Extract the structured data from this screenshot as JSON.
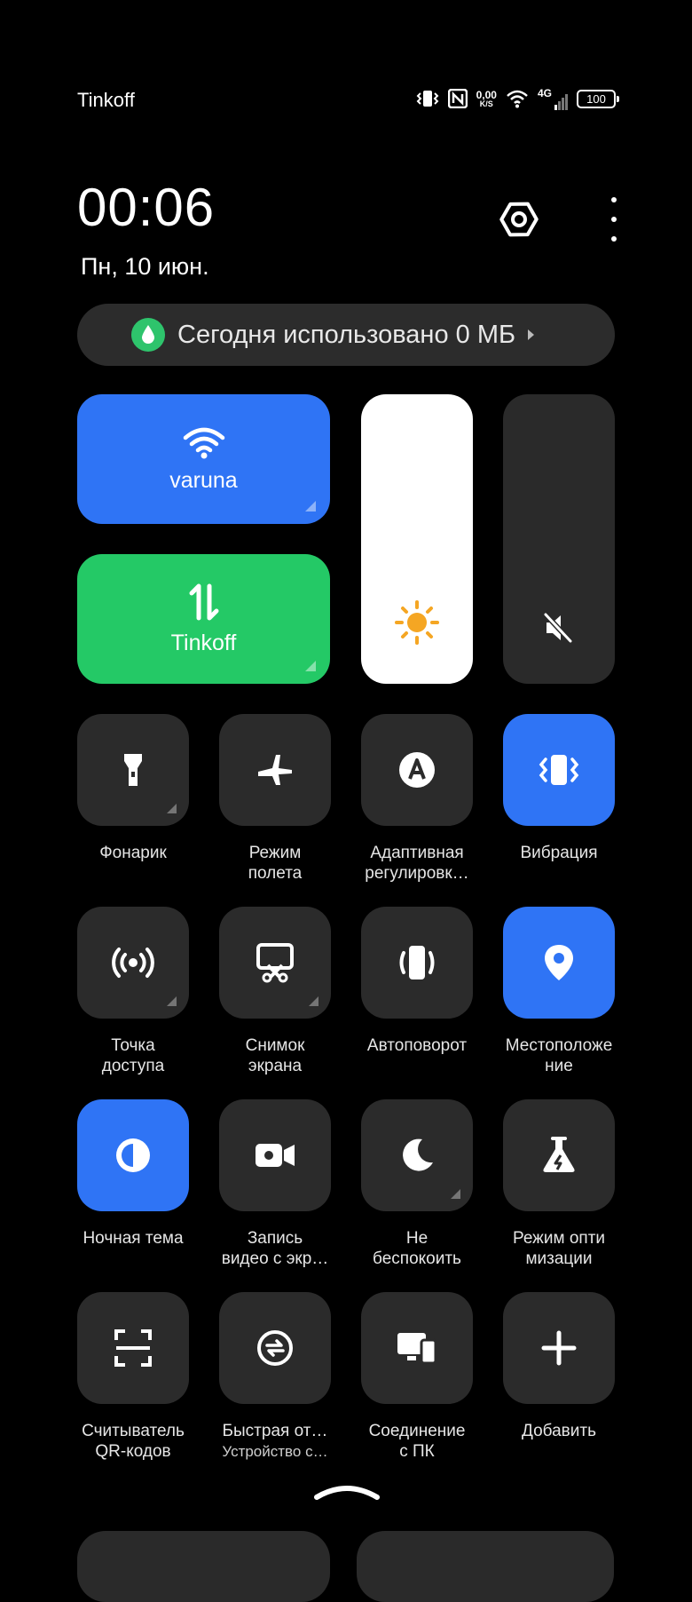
{
  "status_bar": {
    "carrier": "Tinkoff",
    "speed_value": "0,00",
    "speed_unit": "K/S",
    "network_type": "4G",
    "battery": "100",
    "icons": [
      "vibrate-icon",
      "nfc-icon",
      "wifi-icon",
      "cellular-signal-icon",
      "battery-icon"
    ]
  },
  "header": {
    "time": "00:06",
    "date": "Пн, 10 июн."
  },
  "data_usage": {
    "text": "Сегодня использовано 0 МБ"
  },
  "wifi_tile": {
    "label": "varuna",
    "active": true
  },
  "mobile_data_tile": {
    "label": "Tinkoff",
    "active": true
  },
  "sliders": {
    "brightness_level": 1.0,
    "volume_muted": true
  },
  "tiles": [
    {
      "icon": "flashlight-icon",
      "line1": "Фонарик",
      "line2": "",
      "active": false,
      "expandable": true
    },
    {
      "icon": "airplane-icon",
      "line1": "Режим",
      "line2": "полета",
      "active": false,
      "expandable": false
    },
    {
      "icon": "auto-brightness-icon",
      "line1": "Адаптивная",
      "line2": "регулировк…",
      "active": false,
      "expandable": false
    },
    {
      "icon": "vibrate-icon",
      "line1": "Вибрация",
      "line2": "",
      "active": true,
      "expandable": false
    },
    {
      "icon": "hotspot-icon",
      "line1": "Точка",
      "line2": "доступа",
      "active": false,
      "expandable": true
    },
    {
      "icon": "screenshot-icon",
      "line1": "Снимок",
      "line2": "экрана",
      "active": false,
      "expandable": true
    },
    {
      "icon": "auto-rotate-icon",
      "line1": "Автоповорот",
      "line2": "",
      "active": false,
      "expandable": false
    },
    {
      "icon": "location-icon",
      "line1": "Местоположе",
      "line2": "ние",
      "active": true,
      "expandable": false
    },
    {
      "icon": "dark-mode-icon",
      "line1": "Ночная тема",
      "line2": "",
      "active": true,
      "expandable": false
    },
    {
      "icon": "screen-record-icon",
      "line1": "Запись",
      "line2": "видео с экр…",
      "active": false,
      "expandable": false
    },
    {
      "icon": "do-not-disturb-icon",
      "line1": "Не",
      "line2": "беспокоить",
      "active": false,
      "expandable": true
    },
    {
      "icon": "optimization-mode-icon",
      "line1": "Режим опти",
      "line2": "мизации",
      "active": false,
      "expandable": false
    },
    {
      "icon": "qr-scanner-icon",
      "line1": "Считыватель",
      "line2": "QR-кодов",
      "active": false,
      "expandable": false
    },
    {
      "icon": "quick-share-icon",
      "line1": "Быстрая от…",
      "line2": "Устройство с…",
      "active": false,
      "expandable": false,
      "subtitle": true
    },
    {
      "icon": "pc-connect-icon",
      "line1": "Соединение",
      "line2": "с ПК",
      "active": false,
      "expandable": false
    },
    {
      "icon": "add-icon",
      "line1": "Добавить",
      "line2": "",
      "active": false,
      "expandable": false
    }
  ],
  "colors": {
    "background": "#000000",
    "tile": "#2b2b2b",
    "accent_blue": "#2f74f5",
    "accent_green": "#24c966",
    "sun": "#f5a623"
  }
}
